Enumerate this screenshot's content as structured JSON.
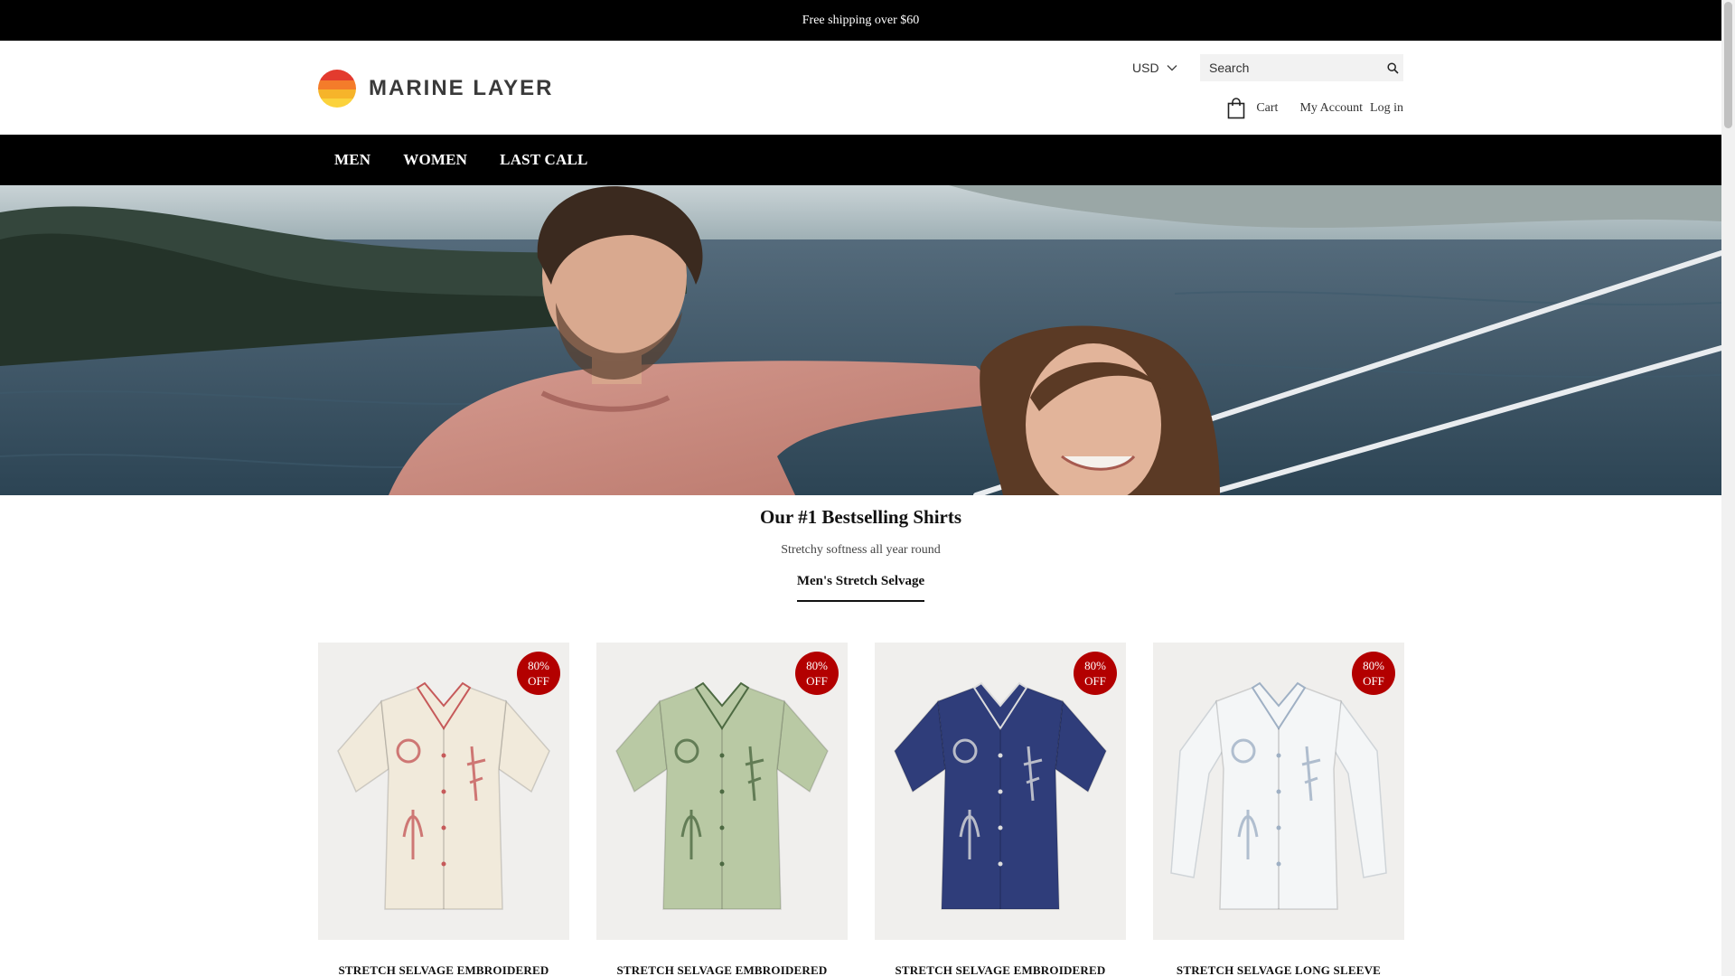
{
  "announcement": "Free shipping over $60",
  "brand": {
    "name": "MARINE LAYER",
    "logo_colors": [
      "#e33b2e",
      "#f47c2a",
      "#f6b42a",
      "#fbd23c"
    ]
  },
  "header": {
    "currency": "USD",
    "search_placeholder": "Search",
    "cart_label": "Cart",
    "account_label": "My Account",
    "login_label": "Log in"
  },
  "nav": {
    "items": [
      "MEN",
      "WOMEN",
      "LAST CALL"
    ]
  },
  "section": {
    "title": "Our #1 Bestselling Shirts",
    "subtitle": "Stretchy softness all year round",
    "tab": "Men's Stretch Selvage"
  },
  "products": [
    {
      "name": "STRETCH SELVAGE EMBROIDERED",
      "badge": "80% OFF",
      "shirt_color": "#f1eadb",
      "accent": "#c65a5a",
      "sleeve": "short"
    },
    {
      "name": "STRETCH SELVAGE EMBROIDERED",
      "badge": "80% OFF",
      "shirt_color": "#b9c9a4",
      "accent": "#4d6a42",
      "sleeve": "short"
    },
    {
      "name": "STRETCH SELVAGE EMBROIDERED",
      "badge": "80% OFF",
      "shirt_color": "#2f3d7a",
      "accent": "#dcdcdc",
      "sleeve": "short"
    },
    {
      "name": "STRETCH SELVAGE LONG SLEEVE",
      "badge": "80% OFF",
      "shirt_color": "#f4f6f7",
      "accent": "#9fb0c4",
      "sleeve": "long"
    }
  ],
  "colors": {
    "announcement_bg": "#000000",
    "nav_bg": "#000000",
    "badge": "#b30000"
  },
  "icons": [
    "search-icon",
    "chevron-down-icon",
    "shopping-bag-icon"
  ]
}
